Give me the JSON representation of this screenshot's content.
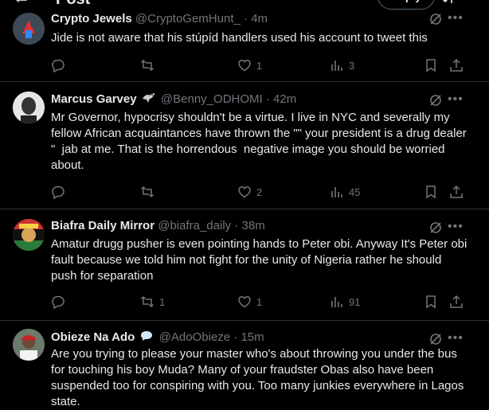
{
  "header": {
    "back_glyph": "←",
    "title": "Post",
    "reply_label": "Reply"
  },
  "tweets": [
    {
      "name": "Crypto Jewels",
      "handle": "@CryptoGemHunt_",
      "time": "4m",
      "text": "Jide is not aware that his stúpíd handlers used his account to tweet this",
      "replies": "",
      "retweets": "",
      "likes": "1",
      "views": "3"
    },
    {
      "name": "Marcus Garvey",
      "handle": "@Benny_ODHOMI",
      "time": "42m",
      "text": "Mr Governor, hypocrisy shouldn't be a virtue. I live in NYC and severally my fellow African acquaintances have thrown the \"\" your president is a drug dealer \"  jab at me. That is the horrendous  negative image you should be worried about.",
      "replies": "",
      "retweets": "",
      "likes": "2",
      "views": "45"
    },
    {
      "name": "Biafra Daily Mirror",
      "handle": "@biafra_daily",
      "time": "38m",
      "text": "Amatur drugg pusher is even pointing hands to Peter obi. Anyway It's Peter obi fault because we told him not fight for the unity of Nigeria rather he should push for separation",
      "replies": "",
      "retweets": "1",
      "likes": "1",
      "views": "91"
    },
    {
      "name": "Obieze Na Ado",
      "handle": "@AdoObieze",
      "time": "15m",
      "text": "Are you trying to please your master who's about throwing you under the bus for touching his boy Muda? Many of your fraudster Obas also have been suspended too for conspiring with you. Too many junkies everywhere in Lagos state.",
      "replies": "",
      "retweets": "",
      "likes": "",
      "views": ""
    }
  ],
  "separator": "·",
  "colors": {
    "background": "#000000",
    "text": "#e7e9ea",
    "muted": "#71767b",
    "divider": "#2f3336",
    "badge_blue": "#1d9bf0"
  }
}
